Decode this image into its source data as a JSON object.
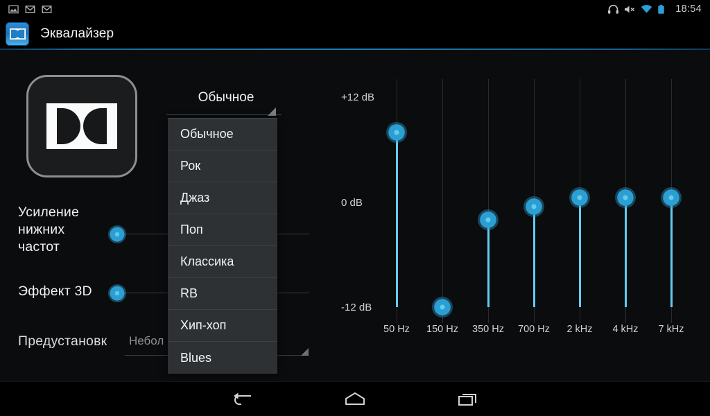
{
  "statusbar": {
    "left_icons": [
      "screenshot-icon",
      "gmail-icon",
      "gmail-icon"
    ],
    "right_icons": [
      "headphones-icon",
      "volume-mute-icon",
      "wifi-icon",
      "battery-icon"
    ],
    "clock": "18:54"
  },
  "actionbar": {
    "icon": "dolby-app-icon",
    "title": "Эквалайзер"
  },
  "badge": {
    "logo": "dolby-double-d-logo"
  },
  "controls": {
    "bass_boost": {
      "label_line1": "Усиление",
      "label_line2": "нижних",
      "label_line3": "частот",
      "state": "on"
    },
    "effect_3d": {
      "label": "Эффект 3D",
      "state": "on"
    },
    "preset": {
      "label": "Предустановк",
      "value": "Небол"
    }
  },
  "spinner": {
    "selected": "Обычное",
    "expanded": true,
    "options": [
      "Обычное",
      "Рок",
      "Джаз",
      "Поп",
      "Классика",
      "RB",
      "Хип-хоп",
      "Blues"
    ]
  },
  "colors": {
    "accent": "#2c9ed2",
    "accent_light": "#62cdf0",
    "background": "#0b0c0e",
    "menu_background": "#2e3134",
    "text": "#f2f4f6"
  },
  "navbar": {
    "back": "back-icon",
    "home": "home-icon",
    "recents": "recents-icon"
  },
  "chart_data": {
    "type": "bar",
    "title": "",
    "xlabel": "",
    "ylabel": "dB",
    "categories": [
      "50 Hz",
      "150 Hz",
      "350 Hz",
      "700 Hz",
      "2 kHz",
      "4 kHz",
      "7 kHz"
    ],
    "values": [
      8.0,
      -12.0,
      -2.0,
      -0.5,
      0.5,
      0.5,
      0.5
    ],
    "ylim": [
      -12,
      12
    ],
    "ytick_labels": [
      "+12 dB",
      "0 dB",
      "-12 dB"
    ],
    "ytick_values": [
      12,
      0,
      -12
    ],
    "grid": true,
    "legend": "none",
    "orientation": "vertical-sliders"
  }
}
